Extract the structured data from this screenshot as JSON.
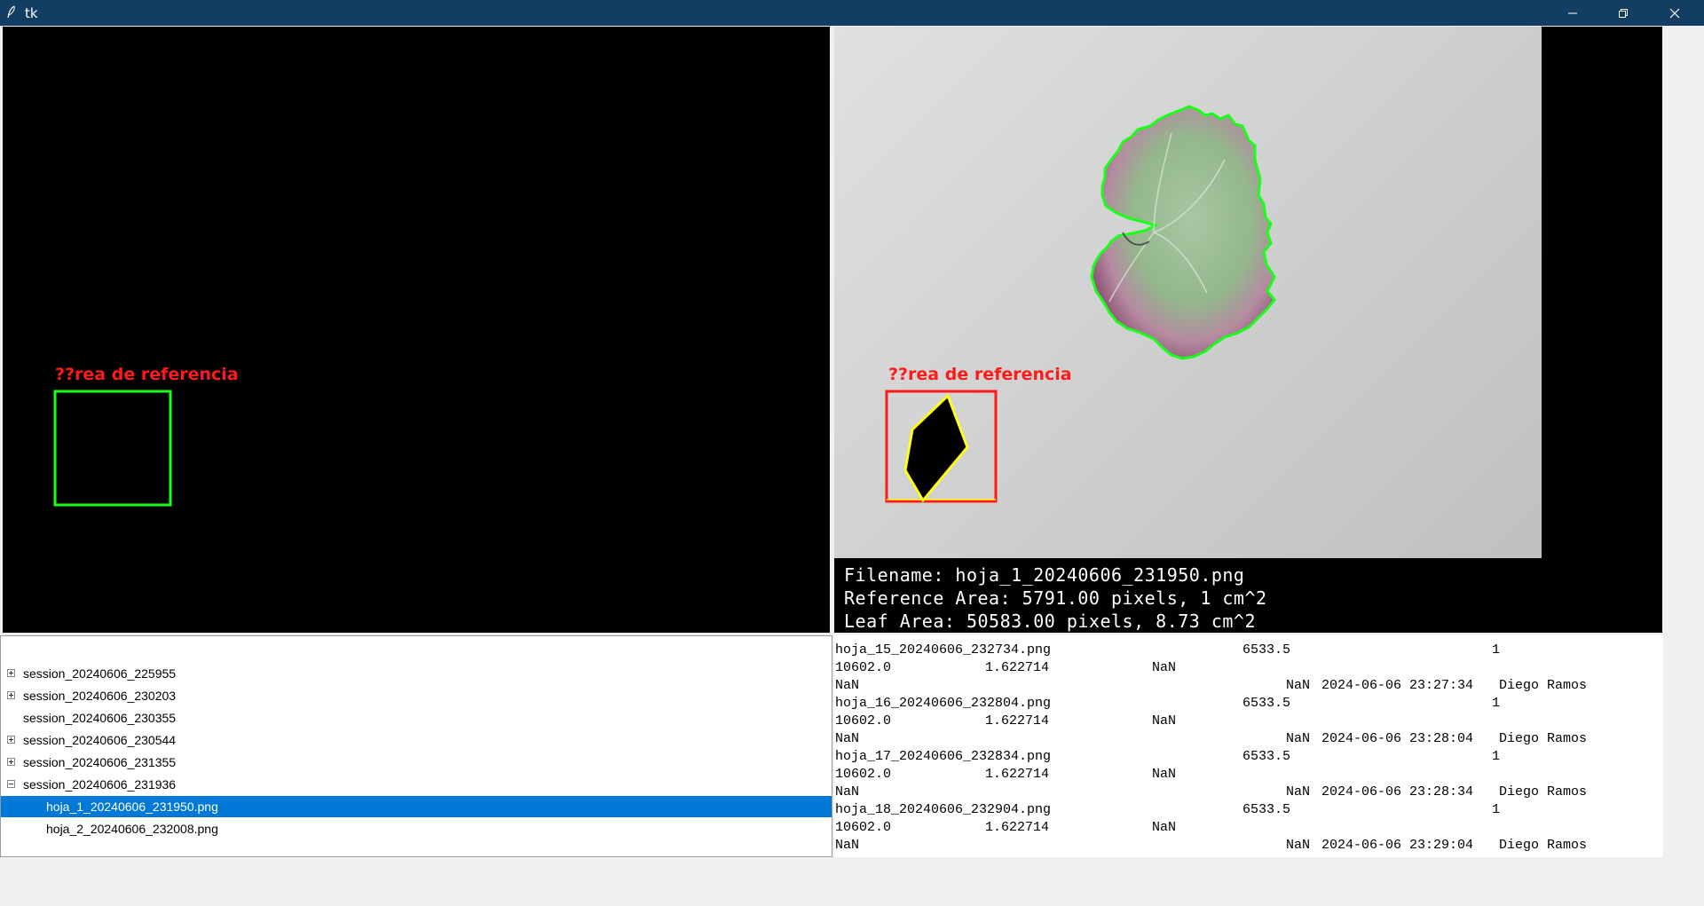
{
  "window": {
    "title": "tk"
  },
  "left_view": {
    "reference_label": "??rea de referencia"
  },
  "right_view": {
    "reference_label": "??rea de referencia",
    "info": [
      "Filename: hoja_1_20240606_231950.png",
      "Reference Area: 5791.00 pixels, 1 cm^2",
      "Leaf Area: 50583.00 pixels, 8.73 cm^2"
    ]
  },
  "tree": {
    "items": [
      {
        "label": "session_20240606_225955",
        "expander": "plus",
        "level": 0,
        "selected": false
      },
      {
        "label": "session_20240606_230203",
        "expander": "plus",
        "level": 0,
        "selected": false
      },
      {
        "label": "session_20240606_230355",
        "expander": "none",
        "level": 0,
        "selected": false
      },
      {
        "label": "session_20240606_230544",
        "expander": "plus",
        "level": 0,
        "selected": false
      },
      {
        "label": "session_20240606_231355",
        "expander": "plus",
        "level": 0,
        "selected": false
      },
      {
        "label": "session_20240606_231936",
        "expander": "minus",
        "level": 0,
        "selected": false
      },
      {
        "label": "hoja_1_20240606_231950.png",
        "expander": "none",
        "level": 1,
        "selected": true
      },
      {
        "label": "hoja_2_20240606_232008.png",
        "expander": "none",
        "level": 1,
        "selected": false
      }
    ]
  },
  "log": {
    "records": [
      {
        "filename": "hoja_15_20240606_232734.png",
        "v1": "6533.5",
        "v2": "1",
        "v3": "10602.0",
        "v4": "1.622714",
        "v5": "NaN",
        "v6": "NaN",
        "v7": "NaN",
        "timestamp": "2024-06-06 23:27:34",
        "user": "Diego Ramos"
      },
      {
        "filename": "hoja_16_20240606_232804.png",
        "v1": "6533.5",
        "v2": "1",
        "v3": "10602.0",
        "v4": "1.622714",
        "v5": "NaN",
        "v6": "NaN",
        "v7": "NaN",
        "timestamp": "2024-06-06 23:28:04",
        "user": "Diego Ramos"
      },
      {
        "filename": "hoja_17_20240606_232834.png",
        "v1": "6533.5",
        "v2": "1",
        "v3": "10602.0",
        "v4": "1.622714",
        "v5": "NaN",
        "v6": "NaN",
        "v7": "NaN",
        "timestamp": "2024-06-06 23:28:34",
        "user": "Diego Ramos"
      },
      {
        "filename": "hoja_18_20240606_232904.png",
        "v1": "6533.5",
        "v2": "1",
        "v3": "10602.0",
        "v4": "1.622714",
        "v5": "NaN",
        "v6": "NaN",
        "v7": "NaN",
        "timestamp": "2024-06-06 23:29:04",
        "user": "Diego Ramos"
      }
    ]
  },
  "colors": {
    "titlebar": "#133e63",
    "selection": "#0078d7",
    "contour_green": "#1aff1a",
    "reference_red": "#ff1a1a",
    "reference_yellow": "#ffff1a"
  }
}
